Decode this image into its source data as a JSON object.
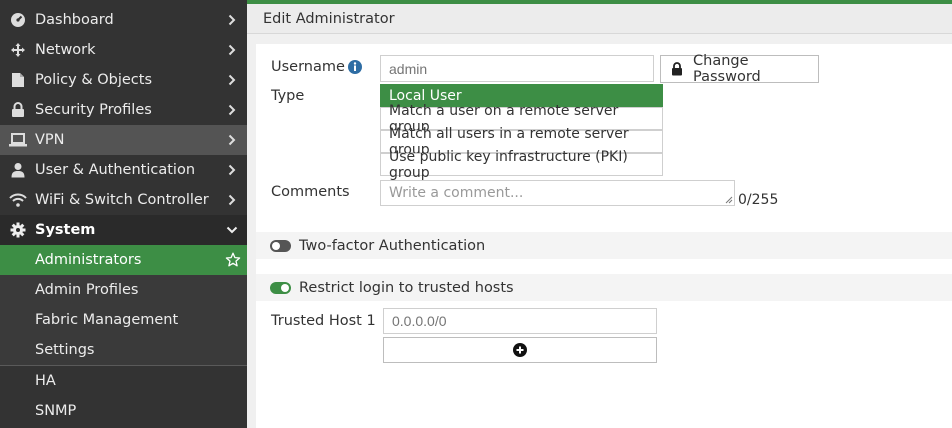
{
  "sidebar": {
    "items": [
      {
        "label": "Dashboard",
        "icon": "dashboard-icon"
      },
      {
        "label": "Network",
        "icon": "network-icon"
      },
      {
        "label": "Policy & Objects",
        "icon": "policy-icon"
      },
      {
        "label": "Security Profiles",
        "icon": "lock-icon"
      },
      {
        "label": "VPN",
        "icon": "laptop-icon"
      },
      {
        "label": "User & Authentication",
        "icon": "user-icon"
      },
      {
        "label": "WiFi & Switch Controller",
        "icon": "wifi-icon"
      },
      {
        "label": "System",
        "icon": "gear-icon"
      }
    ],
    "system_sub": [
      {
        "label": "Administrators"
      },
      {
        "label": "Admin Profiles"
      },
      {
        "label": "Fabric Management"
      },
      {
        "label": "Settings"
      }
    ],
    "more": [
      {
        "label": "HA"
      },
      {
        "label": "SNMP"
      }
    ]
  },
  "header": {
    "title": "Edit Administrator"
  },
  "form": {
    "username_label": "Username",
    "username_placeholder": "admin",
    "change_password": "Change Password",
    "type_label": "Type",
    "type_options": [
      "Local User",
      "Match a user on a remote server group",
      "Match all users in a remote server group",
      "Use public key infrastructure (PKI) group"
    ],
    "comments_label": "Comments",
    "comments_placeholder": "Write a comment...",
    "comments_count": "0/255",
    "two_factor": "Two-factor Authentication",
    "restrict_login": "Restrict login to trusted hosts",
    "trusted_host_label": "Trusted Host 1",
    "trusted_host_placeholder": "0.0.0.0/0"
  },
  "colors": {
    "accent": "#3d8e45",
    "sidebar": "#333333"
  }
}
